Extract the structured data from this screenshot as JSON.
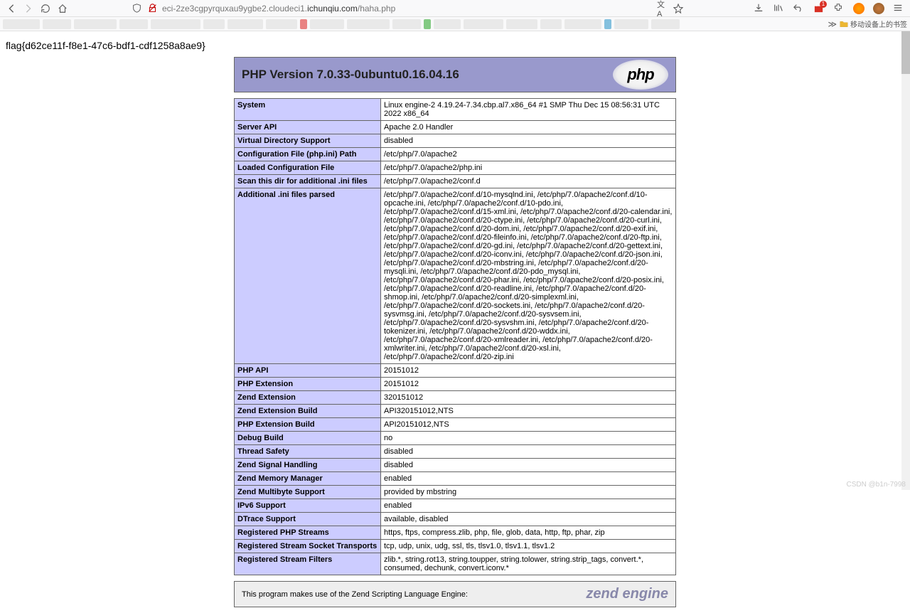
{
  "browser": {
    "url_prefix": "eci-2ze3cgpyrquxau9ygbe2.cloudeci1.",
    "url_domain": "ichunqiu.com",
    "url_path": "/haha.php",
    "bookmark_label": "移动设备上的书签"
  },
  "flag": "flag{d62ce11f-f8e1-47c6-bdf1-cdf1258a8ae9}",
  "php": {
    "title": "PHP Version 7.0.33-0ubuntu0.16.04.16",
    "logo": "php",
    "rows": [
      {
        "k": "System",
        "v": "Linux engine-2 4.19.24-7.34.cbp.al7.x86_64 #1 SMP Thu Dec 15 08:56:31 UTC 2022 x86_64"
      },
      {
        "k": "Server API",
        "v": "Apache 2.0 Handler"
      },
      {
        "k": "Virtual Directory Support",
        "v": "disabled"
      },
      {
        "k": "Configuration File (php.ini) Path",
        "v": "/etc/php/7.0/apache2"
      },
      {
        "k": "Loaded Configuration File",
        "v": "/etc/php/7.0/apache2/php.ini"
      },
      {
        "k": "Scan this dir for additional .ini files",
        "v": "/etc/php/7.0/apache2/conf.d"
      },
      {
        "k": "Additional .ini files parsed",
        "v": "/etc/php/7.0/apache2/conf.d/10-mysqlnd.ini, /etc/php/7.0/apache2/conf.d/10-opcache.ini, /etc/php/7.0/apache2/conf.d/10-pdo.ini, /etc/php/7.0/apache2/conf.d/15-xml.ini, /etc/php/7.0/apache2/conf.d/20-calendar.ini, /etc/php/7.0/apache2/conf.d/20-ctype.ini, /etc/php/7.0/apache2/conf.d/20-curl.ini, /etc/php/7.0/apache2/conf.d/20-dom.ini, /etc/php/7.0/apache2/conf.d/20-exif.ini, /etc/php/7.0/apache2/conf.d/20-fileinfo.ini, /etc/php/7.0/apache2/conf.d/20-ftp.ini, /etc/php/7.0/apache2/conf.d/20-gd.ini, /etc/php/7.0/apache2/conf.d/20-gettext.ini, /etc/php/7.0/apache2/conf.d/20-iconv.ini, /etc/php/7.0/apache2/conf.d/20-json.ini, /etc/php/7.0/apache2/conf.d/20-mbstring.ini, /etc/php/7.0/apache2/conf.d/20-mysqli.ini, /etc/php/7.0/apache2/conf.d/20-pdo_mysql.ini, /etc/php/7.0/apache2/conf.d/20-phar.ini, /etc/php/7.0/apache2/conf.d/20-posix.ini, /etc/php/7.0/apache2/conf.d/20-readline.ini, /etc/php/7.0/apache2/conf.d/20-shmop.ini, /etc/php/7.0/apache2/conf.d/20-simplexml.ini, /etc/php/7.0/apache2/conf.d/20-sockets.ini, /etc/php/7.0/apache2/conf.d/20-sysvmsg.ini, /etc/php/7.0/apache2/conf.d/20-sysvsem.ini, /etc/php/7.0/apache2/conf.d/20-sysvshm.ini, /etc/php/7.0/apache2/conf.d/20-tokenizer.ini, /etc/php/7.0/apache2/conf.d/20-wddx.ini, /etc/php/7.0/apache2/conf.d/20-xmlreader.ini, /etc/php/7.0/apache2/conf.d/20-xmlwriter.ini, /etc/php/7.0/apache2/conf.d/20-xsl.ini, /etc/php/7.0/apache2/conf.d/20-zip.ini"
      },
      {
        "k": "PHP API",
        "v": "20151012"
      },
      {
        "k": "PHP Extension",
        "v": "20151012"
      },
      {
        "k": "Zend Extension",
        "v": "320151012"
      },
      {
        "k": "Zend Extension Build",
        "v": "API320151012,NTS"
      },
      {
        "k": "PHP Extension Build",
        "v": "API20151012,NTS"
      },
      {
        "k": "Debug Build",
        "v": "no"
      },
      {
        "k": "Thread Safety",
        "v": "disabled"
      },
      {
        "k": "Zend Signal Handling",
        "v": "disabled"
      },
      {
        "k": "Zend Memory Manager",
        "v": "enabled"
      },
      {
        "k": "Zend Multibyte Support",
        "v": "provided by mbstring"
      },
      {
        "k": "IPv6 Support",
        "v": "enabled"
      },
      {
        "k": "DTrace Support",
        "v": "available, disabled"
      },
      {
        "k": "Registered PHP Streams",
        "v": "https, ftps, compress.zlib, php, file, glob, data, http, ftp, phar, zip"
      },
      {
        "k": "Registered Stream Socket Transports",
        "v": "tcp, udp, unix, udg, ssl, tls, tlsv1.0, tlsv1.1, tlsv1.2"
      },
      {
        "k": "Registered Stream Filters",
        "v": "zlib.*, string.rot13, string.toupper, string.tolower, string.strip_tags, convert.*, consumed, dechunk, convert.iconv.*"
      }
    ],
    "zend_box": "This program makes use of the Zend Scripting Language Engine:",
    "zend_logo": "zend engine"
  },
  "watermark": "CSDN @b1n-7998"
}
